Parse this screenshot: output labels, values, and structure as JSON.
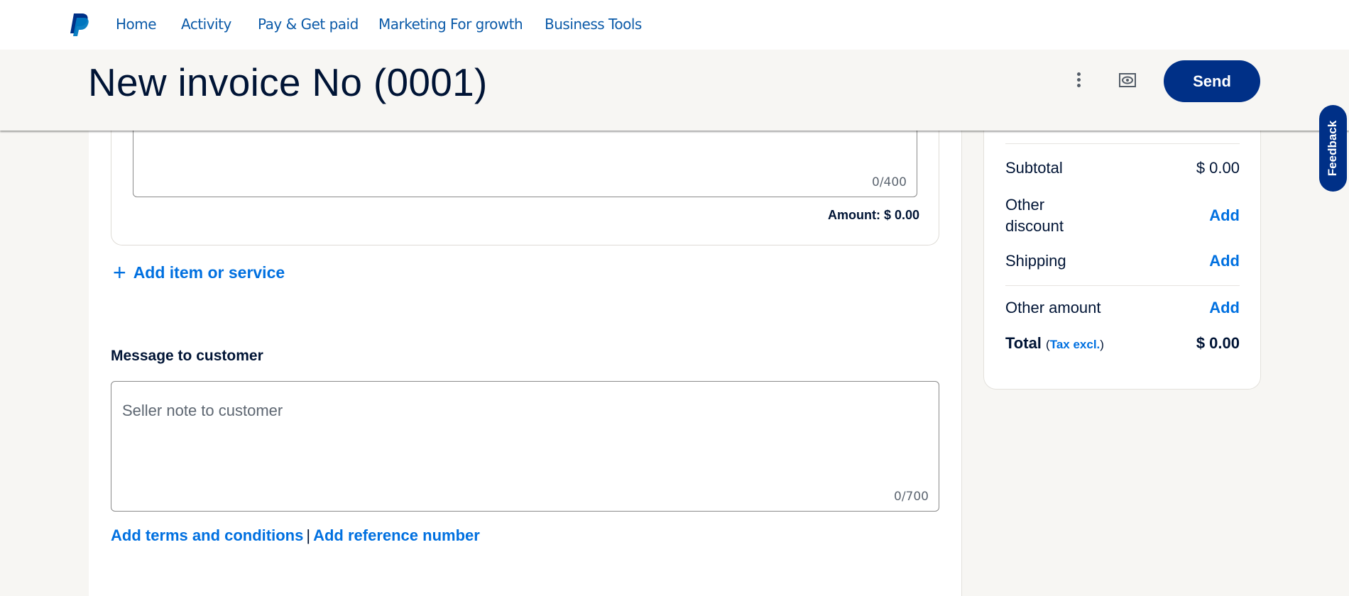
{
  "nav": {
    "logo_icon": "paypal-logo",
    "items": [
      {
        "label": "Home"
      },
      {
        "label": "Activity"
      },
      {
        "label": "Pay & Get paid"
      },
      {
        "label": "Marketing For growth"
      },
      {
        "label": "Business Tools"
      }
    ]
  },
  "header": {
    "title": "New invoice No (0001)",
    "more_icon": "kebab-vertical-icon",
    "preview_icon": "eye-icon",
    "send_label": "Send"
  },
  "item": {
    "description_counter": "0/400",
    "amount_label": "Amount: $ 0.00",
    "add_item_icon": "plus-icon",
    "add_item_label": "Add item or service"
  },
  "message": {
    "heading": "Message to customer",
    "placeholder": "Seller note to customer",
    "counter": "0/700"
  },
  "links": {
    "terms": "Add terms and conditions",
    "separator": "|",
    "reference": "Add reference number"
  },
  "summary": {
    "subtotal_label": "Subtotal",
    "subtotal_value": "$ 0.00",
    "discount_label_1": "Other",
    "discount_label_2": "discount",
    "discount_action": "Add",
    "shipping_label": "Shipping",
    "shipping_action": "Add",
    "other_amount_label": "Other amount",
    "other_amount_action": "Add",
    "total_label": "Total",
    "tax_open": "(",
    "tax_label": "Tax excl.",
    "tax_close": ")",
    "total_value": "$ 0.00"
  },
  "feedback_label": "Feedback",
  "colors": {
    "brand_dark": "#003087",
    "link_blue": "#0070e0",
    "nav_blue": "#0b5aa8",
    "text_dark": "#001435",
    "page_bg": "#f7f6f3"
  }
}
